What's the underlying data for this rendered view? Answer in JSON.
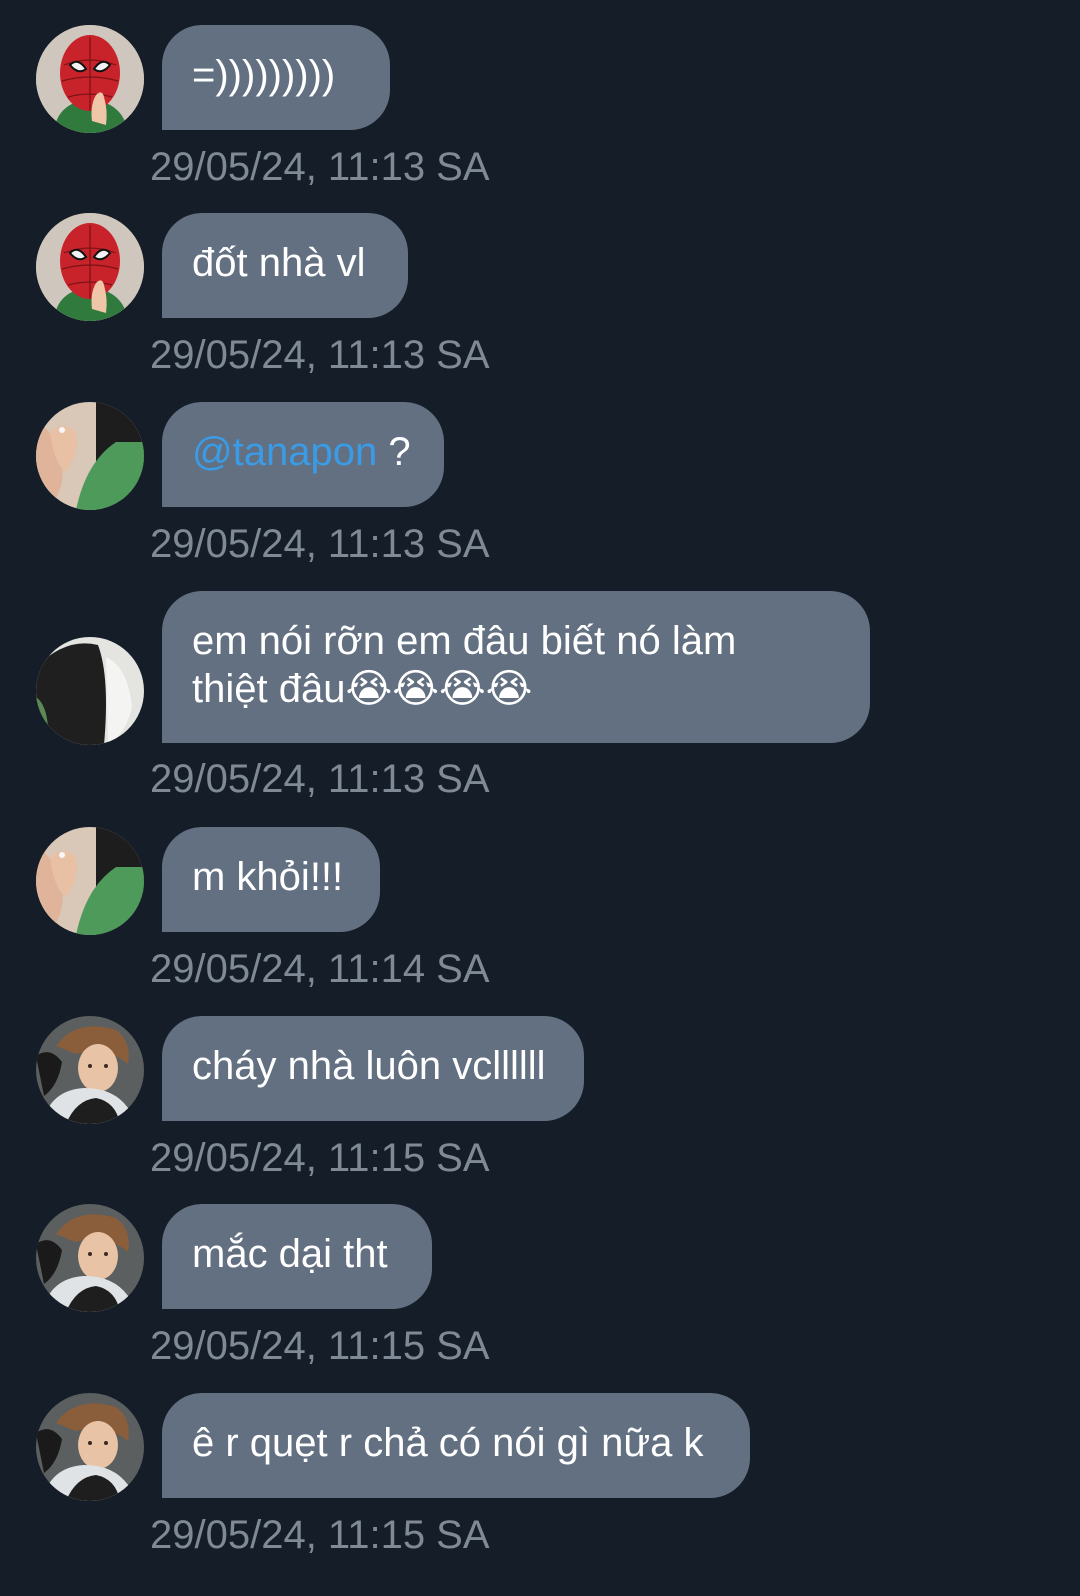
{
  "messages": [
    {
      "avatar": "spiderman-avatar",
      "text": "=)))))))))",
      "timestamp": "29/05/24, 11:13 SA"
    },
    {
      "avatar": "spiderman-avatar",
      "text": "đốt nhà vl",
      "timestamp": "29/05/24, 11:13 SA"
    },
    {
      "avatar": "hand-green-shirt-avatar",
      "mention": "@tanapon",
      "text": " ?",
      "timestamp": "29/05/24, 11:13 SA"
    },
    {
      "avatar": "dark-clothing-avatar",
      "line1": "em nói rỡn em đâu biết nó làm",
      "line2": "thiệt đâu",
      "emojis": "😭😭😭😭",
      "timestamp": "29/05/24, 11:13 SA"
    },
    {
      "avatar": "hand-green-shirt-avatar",
      "text": "m khỏi!!!",
      "timestamp": "29/05/24, 11:14 SA"
    },
    {
      "avatar": "boy-portrait-avatar",
      "text": "cháy nhà luôn vcllllll",
      "timestamp": "29/05/24, 11:15 SA"
    },
    {
      "avatar": "boy-portrait-avatar",
      "text": "mắc dại tht",
      "timestamp": "29/05/24, 11:15 SA"
    },
    {
      "avatar": "boy-portrait-avatar",
      "text": "ê r quẹt r chả có nói gì nữa k",
      "timestamp": "29/05/24, 11:15 SA"
    }
  ],
  "colors": {
    "background": "#151e28",
    "bubble": "#627081",
    "timestamp": "#7f8a96",
    "mention": "#3a9be6"
  }
}
